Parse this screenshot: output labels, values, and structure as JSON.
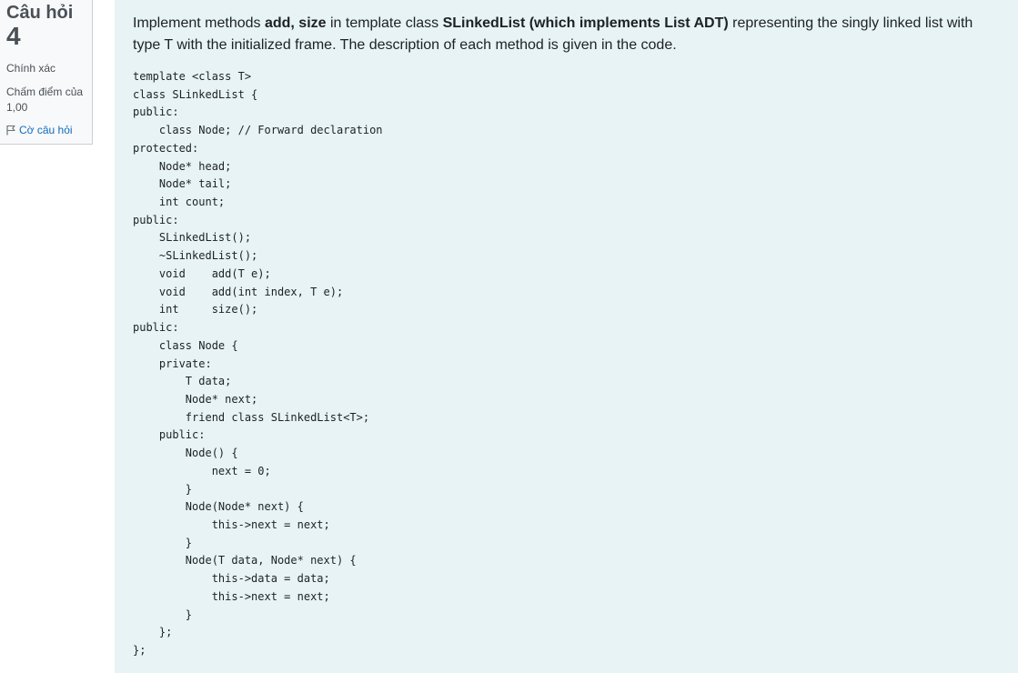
{
  "info": {
    "question_label": "Câu hỏi",
    "question_number": "4",
    "status": "Chính xác",
    "grade": "Chấm điểm của 1,00",
    "flag_label": "Cờ câu hỏi"
  },
  "prompt": {
    "part1": "Implement methods ",
    "bold1": "add, size",
    "part2": " in template class ",
    "bold2": "SLinkedList (which implements List ADT)",
    "part3": " representing the singly linked list with type T with the initialized frame. The description of each method is given in the code."
  },
  "code": "template <class T>\nclass SLinkedList {\npublic:\n    class Node; // Forward declaration\nprotected:\n    Node* head;\n    Node* tail;\n    int count;\npublic:\n    SLinkedList();\n    ~SLinkedList();\n    void    add(T e);\n    void    add(int index, T e);\n    int     size();\npublic:\n    class Node {\n    private:\n        T data;\n        Node* next;\n        friend class SLinkedList<T>;\n    public:\n        Node() {\n            next = 0;\n        }\n        Node(Node* next) {\n            this->next = next;\n        }\n        Node(T data, Node* next) {\n            this->data = data;\n            this->next = next;\n        }\n    };\n};",
  "colors": {
    "content_bg": "#e7f3f5",
    "info_bg": "#f8f9fa",
    "link": "#0f6cbf",
    "text": "#1d2125"
  }
}
